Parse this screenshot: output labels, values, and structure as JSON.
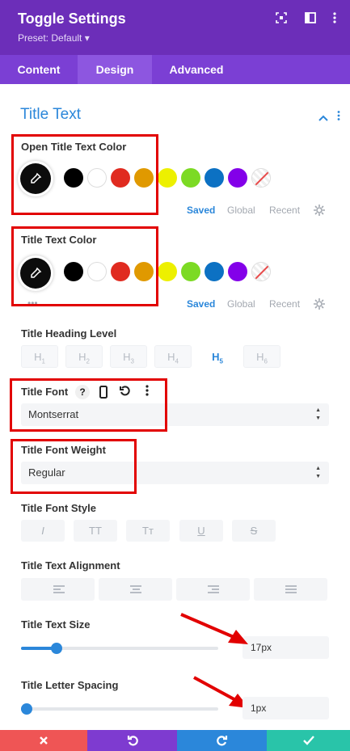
{
  "header": {
    "title": "Toggle Settings",
    "preset": "Preset: Default ▾",
    "icons": [
      "focus-icon",
      "sidebar-icon",
      "kebab-icon"
    ]
  },
  "tabs": [
    {
      "label": "Content",
      "active": false
    },
    {
      "label": "Design",
      "active": true
    },
    {
      "label": "Advanced",
      "active": false
    }
  ],
  "section": {
    "title": "Title Text"
  },
  "colors": {
    "accent": "#2b87da",
    "header_bg": "#6c2eb9",
    "palette": [
      "#000000",
      "#ffffff",
      "#e02b20",
      "#e09900",
      "#edf000",
      "#7cda24",
      "#0c71c3",
      "#8300e9"
    ]
  },
  "open_title_color": {
    "label": "Open Title Text Color",
    "tabs": {
      "saved": "Saved",
      "global": "Global",
      "recent": "Recent"
    }
  },
  "title_color": {
    "label": "Title Text Color",
    "tabs": {
      "saved": "Saved",
      "global": "Global",
      "recent": "Recent"
    }
  },
  "heading_level": {
    "label": "Title Heading Level",
    "options": [
      "H1",
      "H2",
      "H3",
      "H4",
      "H5",
      "H6"
    ],
    "selected": "H5"
  },
  "title_font": {
    "label": "Title Font",
    "value": "Montserrat"
  },
  "font_weight": {
    "label": "Title Font Weight",
    "value": "Regular"
  },
  "font_style": {
    "label": "Title Font Style",
    "options": [
      "I",
      "TT",
      "Tт",
      "U",
      "S"
    ]
  },
  "alignment": {
    "label": "Title Text Alignment"
  },
  "text_size": {
    "label": "Title Text Size",
    "value": "17px",
    "fraction": 0.18
  },
  "letter_spacing": {
    "label": "Title Letter Spacing",
    "value": "1px",
    "fraction": 0.03
  },
  "footer": {
    "buttons": [
      "cancel",
      "undo",
      "redo",
      "save"
    ]
  }
}
